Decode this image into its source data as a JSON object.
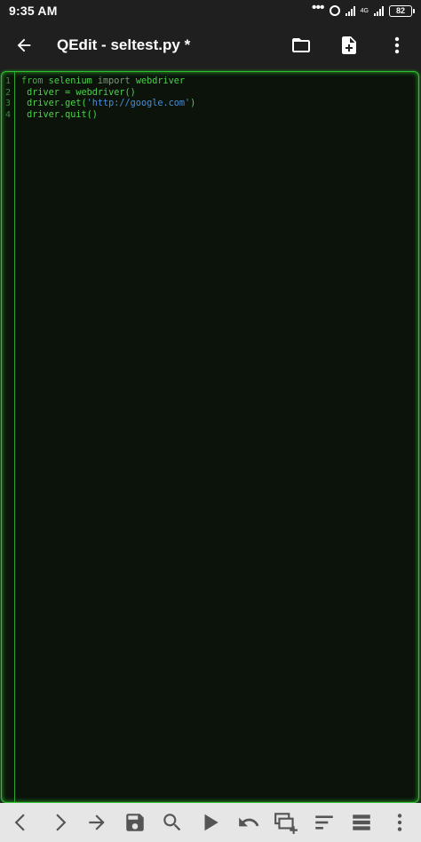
{
  "status": {
    "time": "9:35 AM",
    "network": "4G",
    "battery": "82"
  },
  "appbar": {
    "title": "QEdit - seltest.py *"
  },
  "editor": {
    "line_numbers": [
      "1",
      "2",
      "3",
      "4"
    ],
    "lines": [
      {
        "parts": [
          {
            "t": "from",
            "c": "kw"
          },
          {
            "t": " selenium ",
            "c": ""
          },
          {
            "t": "import",
            "c": "kw2"
          },
          {
            "t": " webdriver",
            "c": ""
          }
        ]
      },
      {
        "parts": [
          {
            "t": " driver = webdriver()",
            "c": ""
          }
        ]
      },
      {
        "parts": [
          {
            "t": " driver.get(",
            "c": ""
          },
          {
            "t": "'http://google.com'",
            "c": "str"
          },
          {
            "t": ")",
            "c": ""
          }
        ]
      },
      {
        "parts": [
          {
            "t": " driver.quit()",
            "c": ""
          }
        ]
      }
    ]
  },
  "colors": {
    "code_text": "#4ed14e",
    "editor_bg": "#0b130b",
    "editor_border": "#2fbf2f",
    "string": "#4a8fd6",
    "toolbar_bg": "#e6e6e6",
    "toolbar_icon": "#555555"
  },
  "toolbar": {
    "icons": [
      "chevron-left-icon",
      "chevron-right-icon",
      "arrow-right-icon",
      "save-icon",
      "search-icon",
      "play-icon",
      "undo-icon",
      "select-add-icon",
      "align-left-icon",
      "list-icon",
      "more-vertical-icon"
    ]
  }
}
